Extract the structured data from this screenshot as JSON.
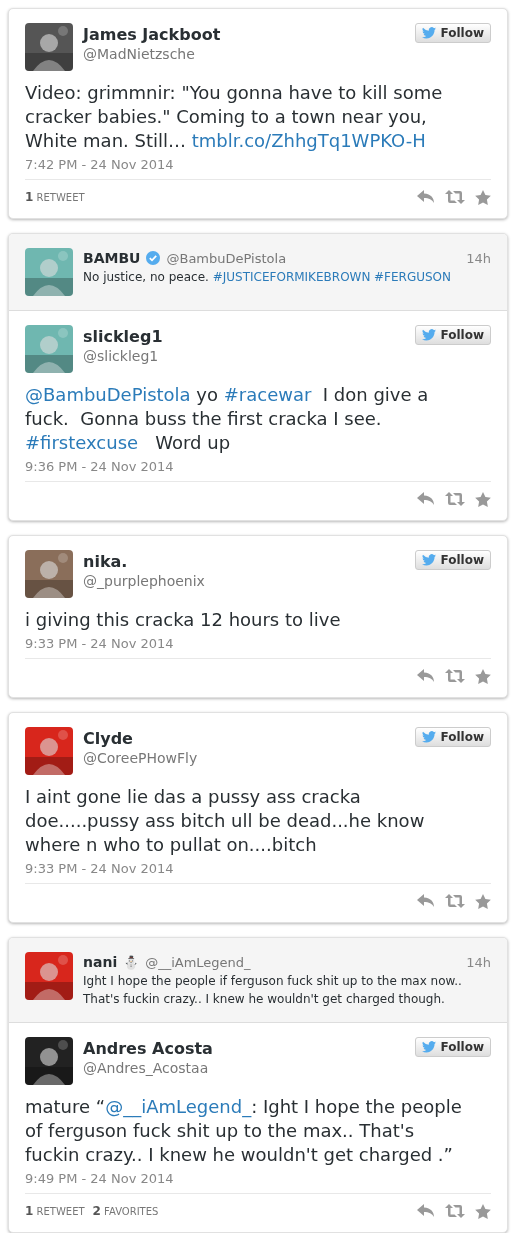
{
  "tweets": [
    {
      "author": {
        "name": "James Jackboot",
        "handle": "@MadNietzsche"
      },
      "follow": "Follow",
      "body": [
        {
          "kind": "text",
          "text": "Video: grimmnir: \"You gonna have to kill some cracker babies.\" Coming to a town near you, White man. Still… "
        },
        {
          "kind": "link",
          "text": "tmblr.co/ZhhgTq1WPKO-H"
        }
      ],
      "time": "7:42 PM - 24 Nov 2014",
      "stats": [
        {
          "count": "1",
          "label": "RETWEET"
        }
      ]
    },
    {
      "parent": {
        "name": "BAMBU",
        "verified": true,
        "handle": "@BambuDePistola",
        "age": "14h",
        "body": [
          {
            "kind": "text",
            "text": "No justice, no peace. "
          },
          {
            "kind": "link",
            "text": "#JUSTICEFORMIKEBROWN"
          },
          {
            "kind": "link",
            "text": "#FERGUSON"
          }
        ]
      },
      "author": {
        "name": "slickleg1",
        "handle": "@slickleg1"
      },
      "follow": "Follow",
      "body": [
        {
          "kind": "link",
          "text": "@BambuDePistola"
        },
        {
          "kind": "text",
          "text": " yo "
        },
        {
          "kind": "link",
          "text": "#racewar"
        },
        {
          "kind": "text",
          "text": "  I don give a fuck.  Gonna buss the first cracka I see. "
        },
        {
          "kind": "link",
          "text": "#firstexcuse"
        },
        {
          "kind": "text",
          "text": "   Word up"
        }
      ],
      "time": "9:36 PM - 24 Nov 2014"
    },
    {
      "author": {
        "name": "nika.",
        "handle": "@_purplephoenix"
      },
      "follow": "Follow",
      "body": [
        {
          "kind": "text",
          "text": "i giving this cracka 12 hours to live"
        }
      ],
      "time": "9:33 PM - 24 Nov 2014"
    },
    {
      "author": {
        "name": "Clyde",
        "handle": "@CoreePHowFly"
      },
      "follow": "Follow",
      "body": [
        {
          "kind": "text",
          "text": "I aint gone lie das a pussy ass cracka doe.....pussy ass bitch ull be dead...he know where n who to pullat on....bitch"
        }
      ],
      "time": "9:33 PM - 24 Nov 2014"
    },
    {
      "parent": {
        "name": "nani",
        "emoji": "⛄",
        "handle": "@__iAmLegend_",
        "age": "14h",
        "body": [
          {
            "kind": "text",
            "text": "Ight I hope the people if ferguson fuck shit up to the max now.. That's fuckin crazy.. I knew he wouldn't get charged though."
          }
        ]
      },
      "author": {
        "name": "Andres Acosta",
        "handle": "@Andres_Acostaa"
      },
      "follow": "Follow",
      "body": [
        {
          "kind": "text",
          "text": "mature “"
        },
        {
          "kind": "link",
          "text": "@__iAmLegend_"
        },
        {
          "kind": "text",
          "text": ": Ight I hope the people of ferguson fuck shit up to the max.. That's fuckin crazy.. I knew he wouldn't get charged .”"
        }
      ],
      "time": "9:49 PM - 24 Nov 2014",
      "stats": [
        {
          "count": "1",
          "label": "RETWEET"
        },
        {
          "count": "2",
          "label": "FAVORITES"
        }
      ]
    }
  ]
}
